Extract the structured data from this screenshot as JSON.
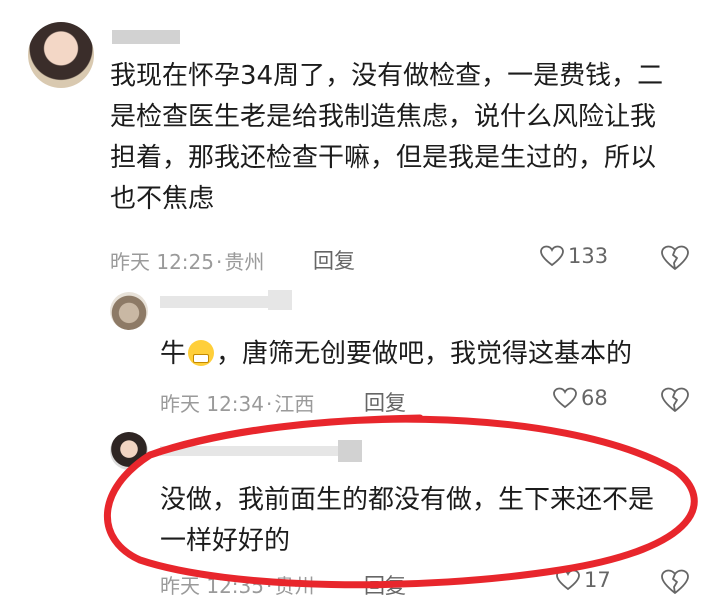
{
  "comments": [
    {
      "text_lines": [
        "我现在怀孕34周了，没有做检查，一是费钱，二",
        "是检查医生老是给我制造焦虑，说什么风险让我",
        "担着，那我还检查干嘛，但是我是生过的，所以",
        "也不焦虑"
      ],
      "time": "昨天 12:25",
      "location": "贵州",
      "reply_label": "回复",
      "likes": "133"
    },
    {
      "text_before_emoji": "牛",
      "text_after_emoji": "，唐筛无创要做吧，我觉得这基本的",
      "time": "昨天 12:34",
      "location": "江西",
      "reply_label": "回复",
      "likes": "68"
    },
    {
      "text_lines": [
        "没做，我前面生的都没有做，生下来还不是",
        "一样好好的"
      ],
      "time": "昨天 12:35",
      "location": "贵州",
      "reply_label": "回复",
      "likes": "17"
    }
  ],
  "icons": [
    "heart-outline-icon",
    "broken-heart-icon",
    "laughing-emoji"
  ],
  "colors": {
    "highlight_circle": "#e8262c",
    "meta_text": "#9a9a9a"
  }
}
